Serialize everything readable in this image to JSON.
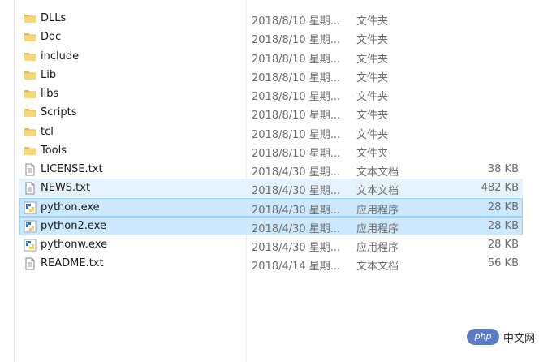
{
  "files": [
    {
      "name": "DLLs",
      "date": "2018/8/10 星期...",
      "type": "文件夹",
      "size": "",
      "icon": "folder-icon",
      "state": ""
    },
    {
      "name": "Doc",
      "date": "2018/8/10 星期...",
      "type": "文件夹",
      "size": "",
      "icon": "folder-icon",
      "state": ""
    },
    {
      "name": "include",
      "date": "2018/8/10 星期...",
      "type": "文件夹",
      "size": "",
      "icon": "folder-icon",
      "state": ""
    },
    {
      "name": "Lib",
      "date": "2018/8/10 星期...",
      "type": "文件夹",
      "size": "",
      "icon": "folder-icon",
      "state": ""
    },
    {
      "name": "libs",
      "date": "2018/8/10 星期...",
      "type": "文件夹",
      "size": "",
      "icon": "folder-icon",
      "state": ""
    },
    {
      "name": "Scripts",
      "date": "2018/8/10 星期...",
      "type": "文件夹",
      "size": "",
      "icon": "folder-icon",
      "state": ""
    },
    {
      "name": "tcl",
      "date": "2018/8/10 星期...",
      "type": "文件夹",
      "size": "",
      "icon": "folder-icon",
      "state": ""
    },
    {
      "name": "Tools",
      "date": "2018/8/10 星期...",
      "type": "文件夹",
      "size": "",
      "icon": "folder-icon",
      "state": ""
    },
    {
      "name": "LICENSE.txt",
      "date": "2018/4/30 星期...",
      "type": "文本文档",
      "size": "38 KB",
      "icon": "text-file-icon",
      "state": ""
    },
    {
      "name": "NEWS.txt",
      "date": "2018/4/30 星期...",
      "type": "文本文档",
      "size": "482 KB",
      "icon": "text-file-icon",
      "state": "hover"
    },
    {
      "name": "python.exe",
      "date": "2018/4/30 星期...",
      "type": "应用程序",
      "size": "28 KB",
      "icon": "python-exe-icon",
      "state": "selected"
    },
    {
      "name": "python2.exe",
      "date": "2018/4/30 星期...",
      "type": "应用程序",
      "size": "28 KB",
      "icon": "python-exe-icon",
      "state": "selected"
    },
    {
      "name": "pythonw.exe",
      "date": "2018/4/30 星期...",
      "type": "应用程序",
      "size": "28 KB",
      "icon": "python-exe-icon",
      "state": ""
    },
    {
      "name": "README.txt",
      "date": "2018/4/14 星期...",
      "type": "文本文档",
      "size": "56 KB",
      "icon": "text-file-icon",
      "state": ""
    }
  ],
  "watermark": {
    "badge": "php",
    "text": "中文网"
  },
  "colors": {
    "selected_bg": "#cce8ff",
    "selected_border": "#99d1ff",
    "hover_bg": "#e5f3ff",
    "folder": "#f8d775"
  }
}
